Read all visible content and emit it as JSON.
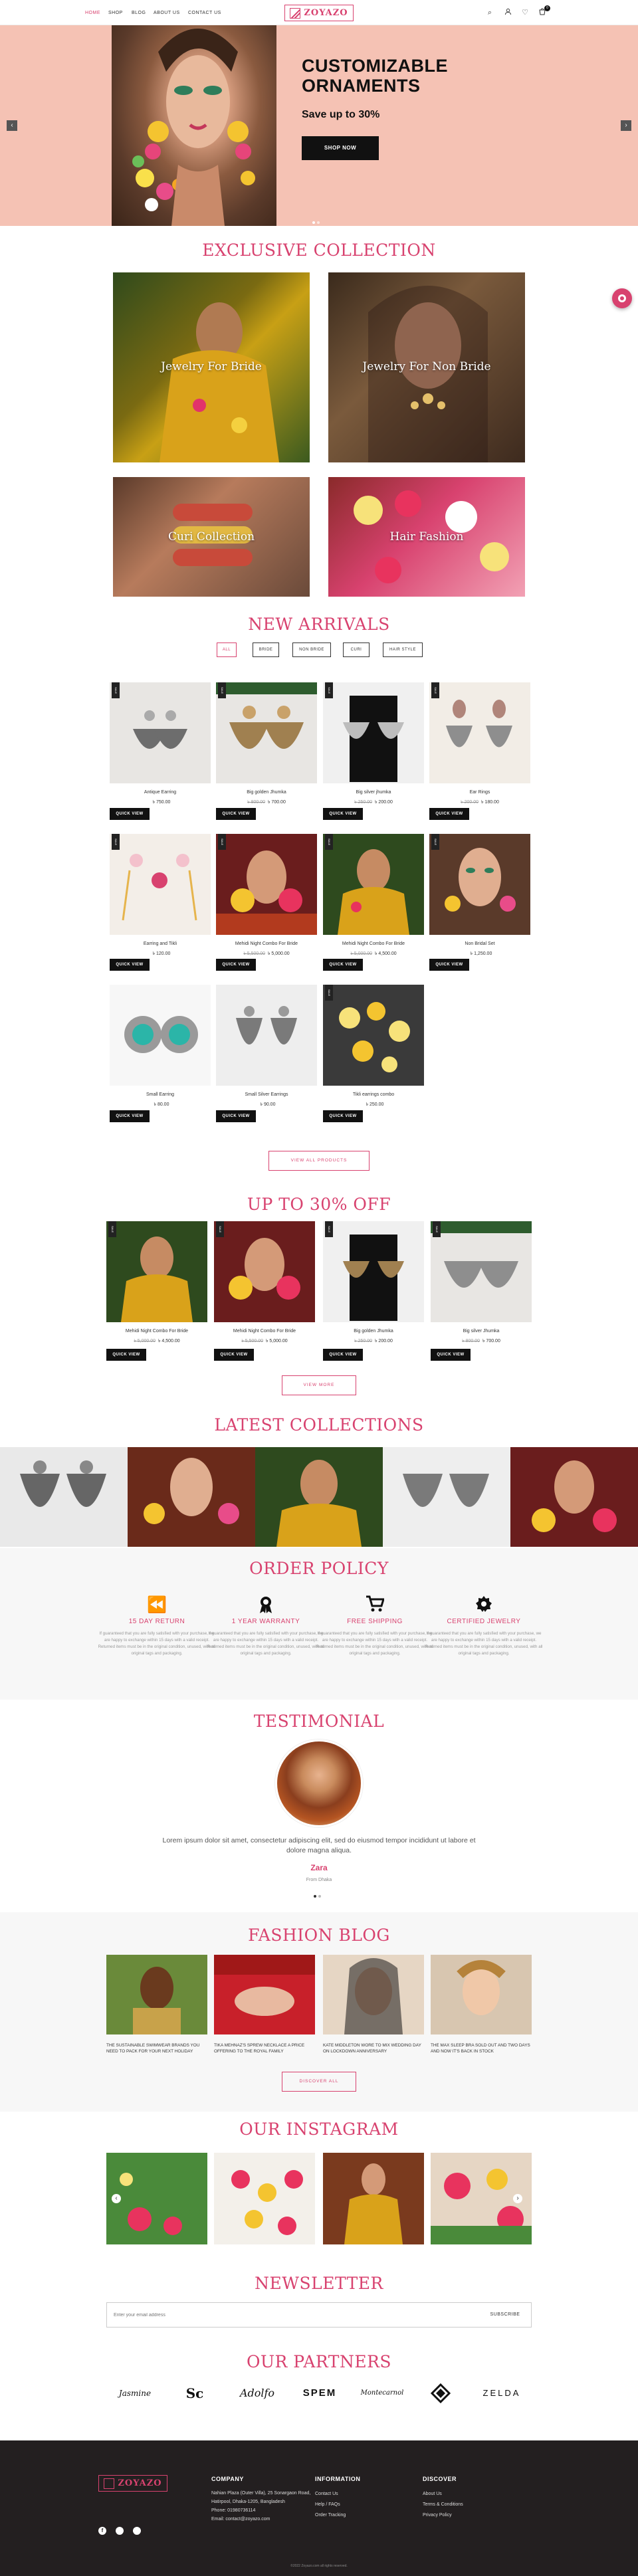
{
  "header": {
    "nav": [
      "HOME",
      "SHOP",
      "BLOG",
      "ABOUT US",
      "CONTACT US"
    ],
    "logo_text": "ZOYAZO",
    "cart_count": "0"
  },
  "hero": {
    "title_line1": "CUSTOMIZABLE",
    "title_line2": "ORNAMENTS",
    "subtitle": "Save up to 30%",
    "cta": "SHOP NOW"
  },
  "exclusive": {
    "title": "EXCLUSIVE COLLECTION",
    "tiles": [
      "Jewelry For Bride",
      "Jewelry For Non Bride",
      "Curi Collection",
      "Hair Fashion"
    ]
  },
  "arrivals": {
    "title": "NEW ARRIVALS",
    "filters": [
      "ALL",
      "BRIDE",
      "NON BRIDE",
      "CURI",
      "HAIR STYLE"
    ],
    "badge": "SALE",
    "products": [
      {
        "name": "Antique Earring",
        "old": "",
        "price": "৳ 750.00"
      },
      {
        "name": "Big golden Jhumka",
        "old": "৳ 800.00",
        "price": "৳ 700.00"
      },
      {
        "name": "Big silver jhumka",
        "old": "৳ 250.00",
        "price": "৳ 200.00"
      },
      {
        "name": "Ear Rings",
        "old": "৳ 200.00",
        "price": "৳ 180.00"
      },
      {
        "name": "Earring and Tikli",
        "old": "",
        "price": "৳ 120.00"
      },
      {
        "name": "Mehidi Night Combo For Bride",
        "old": "৳ 5,500.00",
        "price": "৳ 5,000.00"
      },
      {
        "name": "Mehidi Night Combo For Bride",
        "old": "৳ 5,000.00",
        "price": "৳ 4,500.00"
      },
      {
        "name": "Non Bridal Set",
        "old": "",
        "price": "৳ 1,250.00"
      },
      {
        "name": "Small Earring",
        "old": "",
        "price": "৳ 80.00"
      },
      {
        "name": "Small Silver Earrings",
        "old": "",
        "price": "৳ 90.00"
      },
      {
        "name": "Tikli earrings combo",
        "old": "",
        "price": "৳ 250.00"
      }
    ],
    "quick_view": "QUICK VIEW",
    "view_all": "VIEW ALL PRODUCTS"
  },
  "sale": {
    "title": "UP TO 30% OFF",
    "products": [
      {
        "name": "Mehidi Night Combo For Bride",
        "old": "৳ 5,000.00",
        "price": "৳ 4,500.00"
      },
      {
        "name": "Mehidi Night Combo For Bride",
        "old": "৳ 5,500.00",
        "price": "৳ 5,000.00"
      },
      {
        "name": "Big golden Jhumka",
        "old": "৳ 250.00",
        "price": "৳ 200.00"
      },
      {
        "name": "Big silver Jhumka",
        "old": "৳ 800.00",
        "price": "৳ 700.00"
      }
    ],
    "view_more": "VIEW MORE"
  },
  "latest": {
    "title": "LATEST COLLECTIONS"
  },
  "policy": {
    "title": "ORDER POLICY",
    "items": [
      {
        "icon": "rewind-icon",
        "title": "15 DAY RETURN",
        "desc": "If guaranteed that you are fully satisfied with your purchase, we are happy to exchange within 15 days with a valid receipt. Returned items must be in the original condition, unused, with all original tags and packaging."
      },
      {
        "icon": "award-icon",
        "title": "1 YEAR WARRANTY",
        "desc": "If guaranteed that you are fully satisfied with your purchase, we are happy to exchange within 15 days with a valid receipt. Returned items must be in the original condition, unused, with all original tags and packaging."
      },
      {
        "icon": "cart-icon",
        "title": "FREE SHIPPING",
        "desc": "If guaranteed that you are fully satisfied with your purchase, we are happy to exchange within 15 days with a valid receipt. Returned items must be in the original condition, unused, with all original tags and packaging."
      },
      {
        "icon": "certificate-icon",
        "title": "CERTIFIED JEWELRY",
        "desc": "If guaranteed that you are fully satisfied with your purchase, we are happy to exchange within 15 days with a valid receipt. Returned items must be in the original condition, unused, with all original tags and packaging."
      }
    ]
  },
  "testimonial": {
    "title": "TESTIMONIAL",
    "quote": "Lorem ipsum dolor sit amet, consectetur adipiscing elit, sed do eiusmod tempor incididunt ut labore et dolore magna aliqua.",
    "name": "Zara",
    "role": "From Dhaka"
  },
  "blog": {
    "title": "FASHION BLOG",
    "posts": [
      "THE SUSTAINABLE SWIMWEAR BRANDS YOU NEED TO PACK FOR YOUR NEXT HOLIDAY",
      "TIKA MEHNAZ'S SPREW NECKLACE A PRICE OFFERING TO THE ROYAL FAMILY",
      "KATE MIDDLETON WORE TO MIX WEDDING DAY ON LOCKDOWN ANNIVERSARY",
      "THE MAX SLEEP BRA SOLD OUT AND TWO DAYS AND NOW IT'S BACK IN STOCK"
    ],
    "discover": "DISCOVER ALL"
  },
  "instagram": {
    "title": "OUR INSTAGRAM"
  },
  "newsletter": {
    "title": "NEWSLETTER",
    "placeholder": "Enter your email address",
    "button": "SUBSCRIBE"
  },
  "partners": {
    "title": "OUR PARTNERS",
    "names": [
      "Jasmine",
      "Sc",
      "Adolfo",
      "SPEM",
      "Montecarnol",
      "",
      "ZELDA"
    ]
  },
  "footer": {
    "logo_text": "ZOYAZO",
    "company_head": "COMPANY",
    "company_lines": [
      "Nahian Plaza (Outer Villa), 25 Sonargaon Road,",
      "Hatirpool, Dhaka-1205, Bangladesh",
      "Phone: 01980736114",
      "Email: contact@zoyazo.com"
    ],
    "info_head": "INFORMATION",
    "info_links": [
      "Contact Us",
      "Help / FAQs",
      "Order Tracking"
    ],
    "discover_head": "DISCOVER",
    "discover_links": [
      "About Us",
      "Terms & Conditions",
      "Privacy Policy"
    ],
    "copyright": "©2022 Zoyazo.com all rights reserved."
  }
}
